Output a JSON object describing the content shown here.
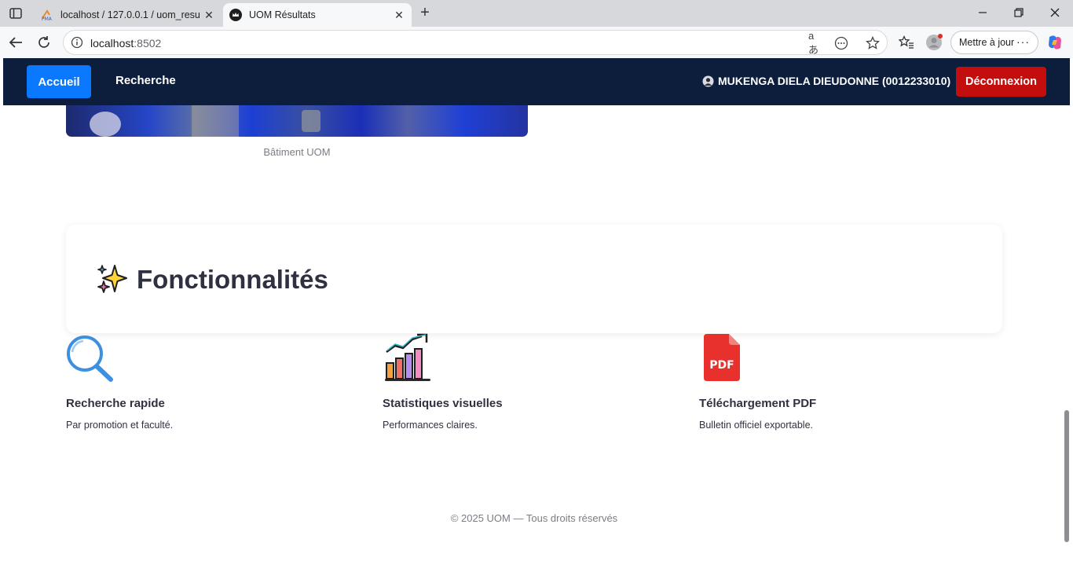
{
  "browser": {
    "tabs": [
      {
        "title": "localhost / 127.0.0.1 / uom_resultats",
        "favicon": "phpmyadmin-icon",
        "active": false
      },
      {
        "title": "UOM Résultats",
        "favicon": "crown-icon",
        "active": true
      }
    ],
    "address": {
      "host": "localhost",
      "port": ":8502"
    },
    "update_label": "Mettre à jour"
  },
  "nav": {
    "home_label": "Accueil",
    "search_label": "Recherche",
    "user_label": "MUKENGA DIELA DIEUDONNE (0012233010)",
    "logout_label": "Déconnexion"
  },
  "hero": {
    "caption": "Bâtiment UOM"
  },
  "features": {
    "heading": "Fonctionnalités",
    "heading_icon": "sparkles-icon",
    "items": [
      {
        "title": "Recherche rapide",
        "description": "Par promotion et faculté.",
        "icon": "magnifier-icon"
      },
      {
        "title": "Statistiques visuelles",
        "description": "Performances claires.",
        "icon": "bar-chart-icon"
      },
      {
        "title": "Téléchargement PDF",
        "description": "Bulletin officiel exportable.",
        "icon": "pdf-icon"
      }
    ]
  },
  "footer": {
    "text": "© 2025 UOM — Tous droits réservés"
  },
  "colors": {
    "nav_background": "#0c1e3b",
    "primary_button": "#0a78ff",
    "logout_button": "#c40d0d"
  }
}
